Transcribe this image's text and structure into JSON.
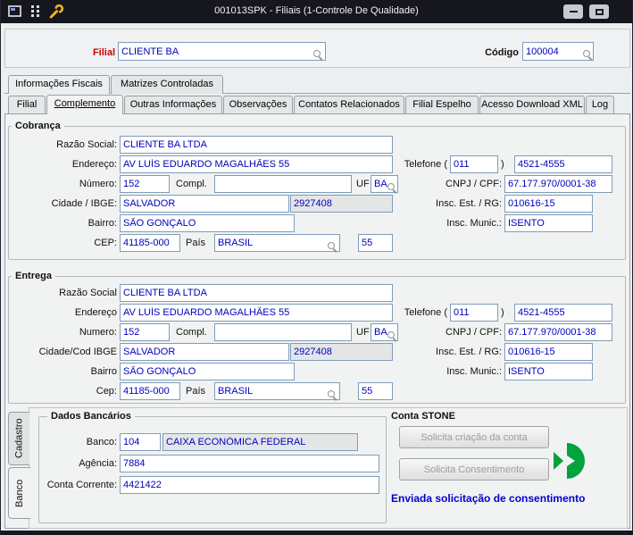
{
  "window": {
    "title": "001013SPK - Filiais (1-Controle De Qualidade)"
  },
  "icons": {
    "app": "form-window",
    "menu_grid": "dot-grid",
    "wrench": "wrench",
    "minimize": "minimize-bar",
    "maximize": "maximize-box",
    "lookup": "magnifier",
    "stone": "split-green-circle"
  },
  "colors": {
    "titlebar_bg": "#16161e",
    "field_text": "#0000c0",
    "filial_label": "#c80000",
    "status_text": "#0000cc",
    "stone_green": "#00a33c"
  },
  "header": {
    "filial_label": "Filial",
    "filial_value": "CLIENTE BA",
    "codigo_label": "Código",
    "codigo_value": "100004"
  },
  "tabs_top": [
    {
      "label": "Informações Fiscais",
      "active": true
    },
    {
      "label": "Matrizes Controladas",
      "active": false
    }
  ],
  "tabs_main": [
    {
      "label": "Filial",
      "active": false
    },
    {
      "label": "Complemento",
      "active": true
    },
    {
      "label": "Outras Informações",
      "active": false
    },
    {
      "label": "Observações",
      "active": false
    },
    {
      "label": "Contatos Relacionados",
      "active": false
    },
    {
      "label": "Filial Espelho",
      "active": false
    },
    {
      "label": "Acesso Download XML",
      "active": false
    },
    {
      "label": "Log",
      "active": false
    }
  ],
  "cobranca": {
    "title": "Cobrança",
    "razao_social": {
      "label": "Razão Social:",
      "value": "CLIENTE BA LTDA"
    },
    "endereco": {
      "label": "Endereço:",
      "value": "AV LUÍS EDUARDO MAGALHÃES 55"
    },
    "numero": {
      "label": "Número:",
      "value": "152"
    },
    "compl": {
      "label": "Compl.",
      "value": ""
    },
    "uf": {
      "label": "UF",
      "value": "BA"
    },
    "cidade": {
      "label": "Cidade / IBGE:",
      "value": "SALVADOR"
    },
    "ibge": "2927408",
    "bairro": {
      "label": "Bairro:",
      "value": "SÃO GONÇALO"
    },
    "cep": {
      "label": "CEP:",
      "value": "41185-000"
    },
    "pais": {
      "label": "País",
      "value": "BRASIL"
    },
    "pais_cod": "55",
    "telefone": {
      "label": "Telefone (",
      "paren": ")",
      "ddd": "011",
      "numero": "4521-4555"
    },
    "cnpj": {
      "label": "CNPJ / CPF:",
      "value": "67.177.970/0001-38"
    },
    "insc_est": {
      "label": "Insc. Est. / RG:",
      "value": "010616-15"
    },
    "insc_mun": {
      "label": "Insc. Munic.:",
      "value": "ISENTO"
    }
  },
  "entrega": {
    "title": "Entrega",
    "razao_social": {
      "label": "Razão Social",
      "value": "CLIENTE BA LTDA"
    },
    "endereco": {
      "label": "Endereço",
      "value": "AV LUÍS EDUARDO MAGALHÃES 55"
    },
    "numero": {
      "label": "Numero:",
      "value": "152"
    },
    "compl": {
      "label": "Compl.",
      "value": ""
    },
    "uf": {
      "label": "UF",
      "value": "BA"
    },
    "cidade": {
      "label": "Cidade/Cod IBGE",
      "value": "SALVADOR"
    },
    "ibge": "2927408",
    "bairro": {
      "label": "Bairro",
      "value": "SÃO GONÇALO"
    },
    "cep": {
      "label": "Cep:",
      "value": "41185-000"
    },
    "pais": {
      "label": "País",
      "value": "BRASIL"
    },
    "pais_cod": "55",
    "telefone": {
      "label": "Telefone (",
      "paren": ")",
      "ddd": "011",
      "numero": "4521-4555"
    },
    "cnpj": {
      "label": "CNPJ / CPF:",
      "value": "67.177.970/0001-38"
    },
    "insc_est": {
      "label": "Insc. Est. / RG:",
      "value": "010616-15"
    },
    "insc_mun": {
      "label": "Insc. Munic.:",
      "value": "ISENTO"
    }
  },
  "side_tabs": [
    {
      "label": "Cadastro",
      "active": false
    },
    {
      "label": "Banco",
      "active": true
    }
  ],
  "dados_bancarios": {
    "title": "Dados Bancários",
    "banco": {
      "label": "Banco:",
      "code": "104",
      "nome": "CAIXA ECONÔMICA FEDERAL"
    },
    "agencia": {
      "label": "Agência:",
      "value": "7884"
    },
    "conta_corrente": {
      "label": "Conta Corrente:",
      "value": "4421422"
    }
  },
  "conta_stone": {
    "title": "Conta STONE",
    "solicita_criacao": "Solicita criação da conta",
    "solicita_consentimento": "Solicita Consentimento",
    "status": "Enviada solicitação de consentimento"
  }
}
